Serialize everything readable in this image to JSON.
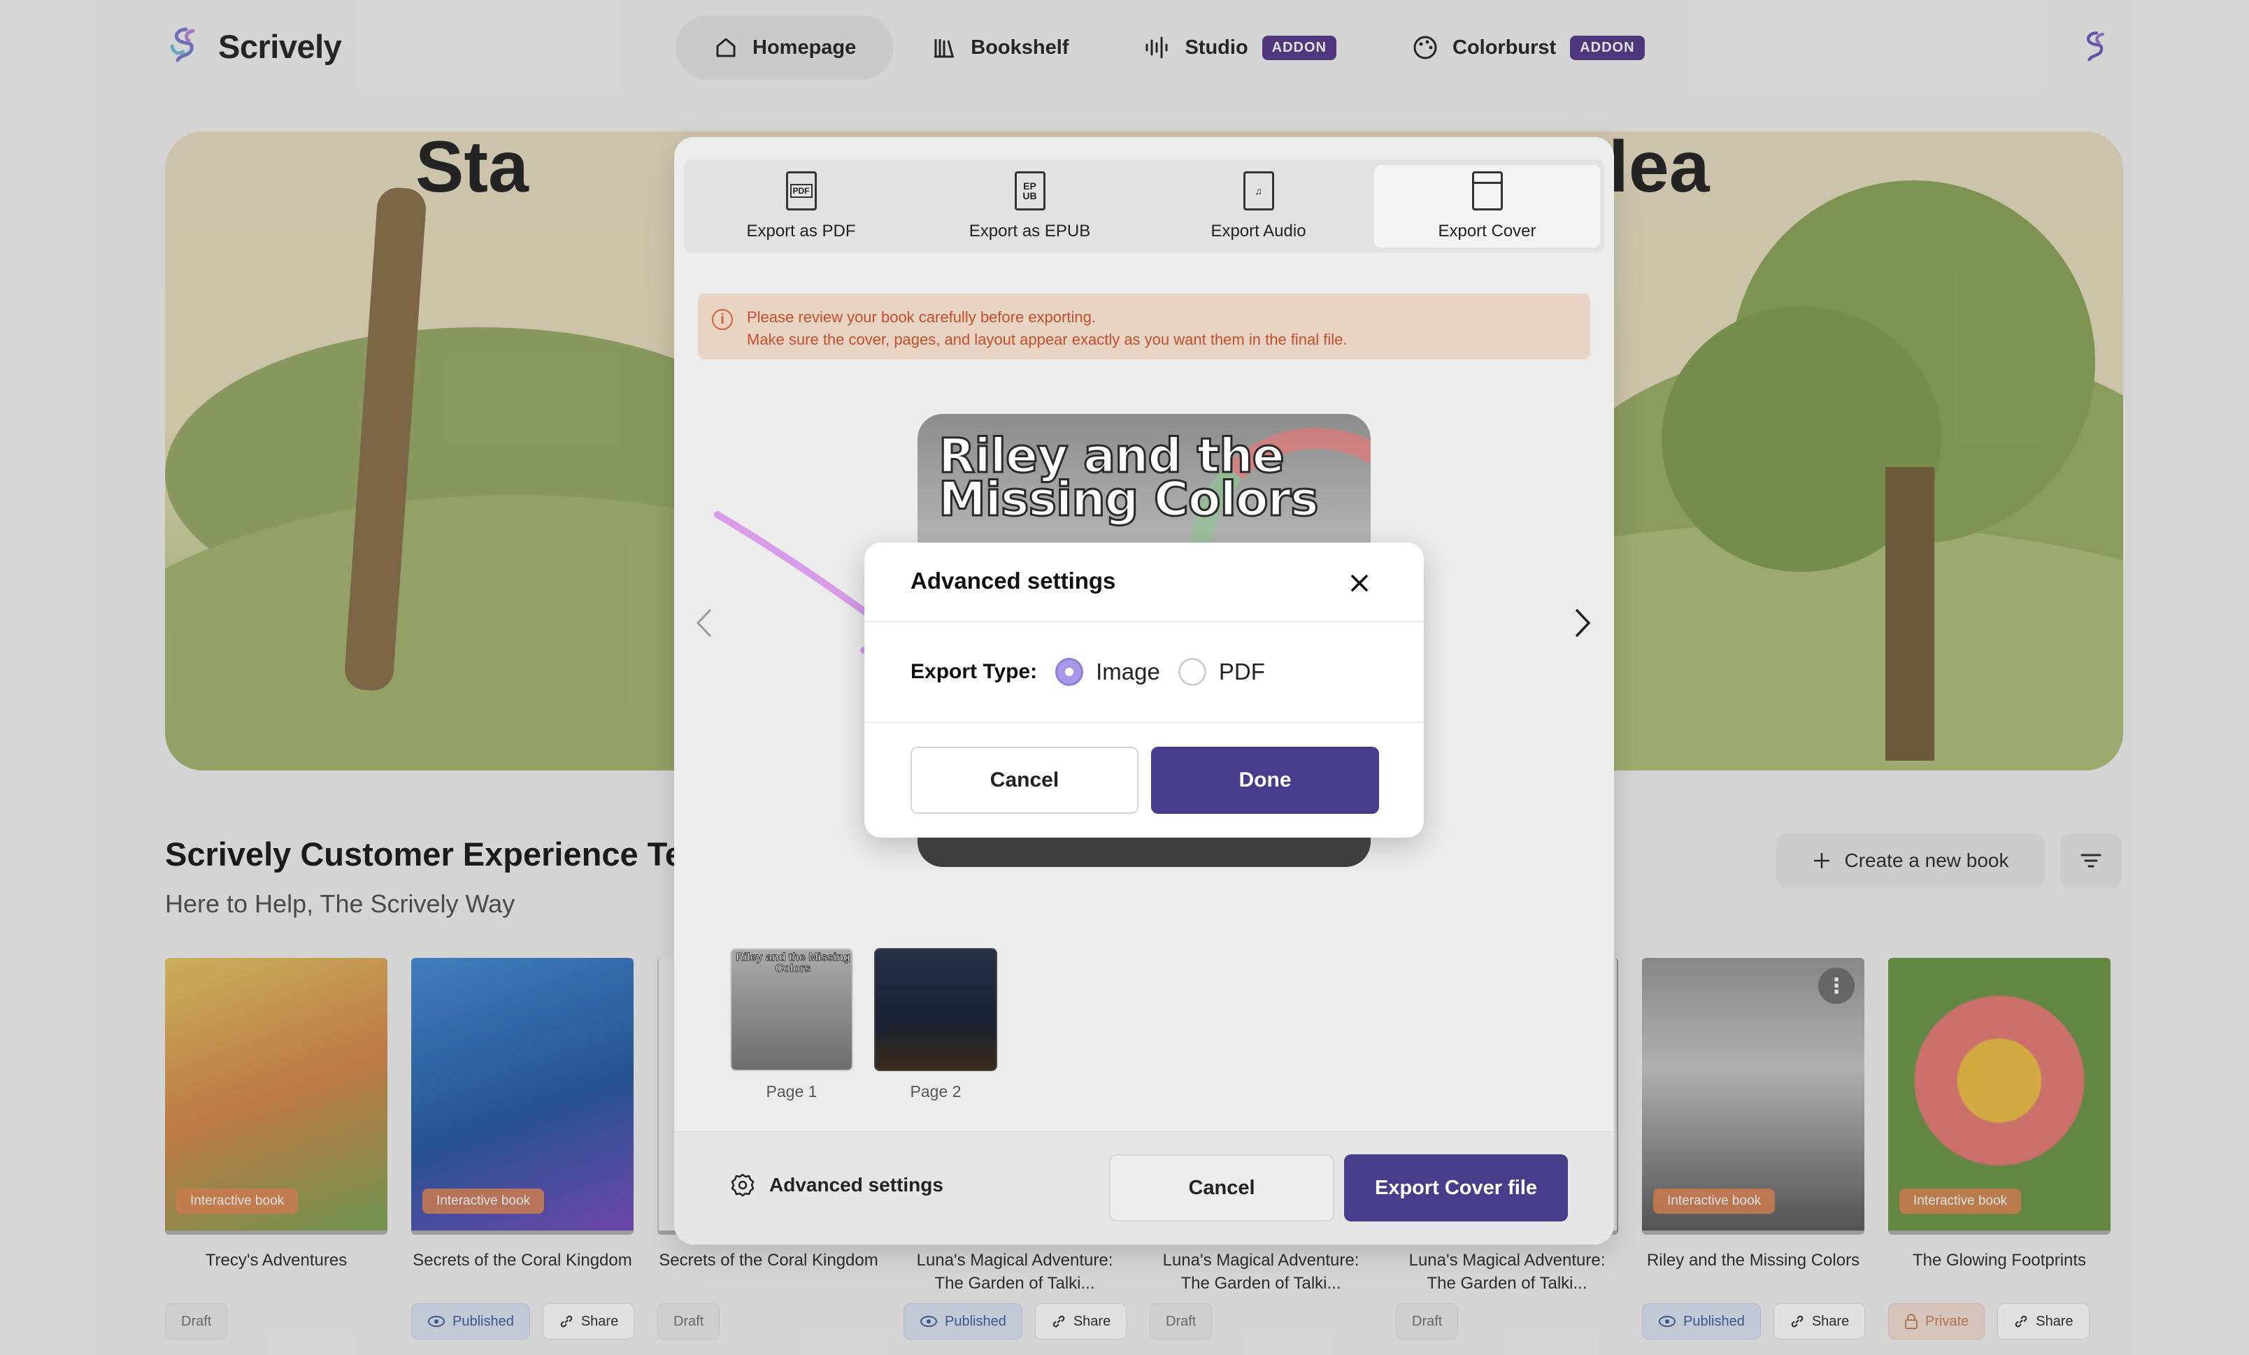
{
  "app": {
    "name": "Scrively"
  },
  "nav": {
    "items": [
      {
        "label": "Homepage",
        "icon": "home-icon"
      },
      {
        "label": "Bookshelf",
        "icon": "bookshelf-icon"
      },
      {
        "label": "Studio",
        "icon": "waveform-icon",
        "badge": "ADDON"
      },
      {
        "label": "Colorburst",
        "icon": "palette-icon",
        "badge": "ADDON"
      }
    ],
    "active": "Homepage"
  },
  "hero": {
    "title_left": "Sta",
    "title_right": "lea"
  },
  "section": {
    "title": "Scrively Customer Experience Te",
    "subtitle": "Here to Help, The Scrively Way",
    "create_label": "Create a new book"
  },
  "books": [
    {
      "title": "Trecy's Adventures",
      "badge": "Interactive book",
      "status": "Draft",
      "share": ""
    },
    {
      "title": "Secrets of the Coral Kingdom",
      "badge": "Interactive book",
      "status": "Published",
      "share": "Share"
    },
    {
      "title": "Secrets of the Coral Kingdom",
      "badge": "",
      "status": "Draft",
      "share": ""
    },
    {
      "title": "Luna's Magical Adventure: The Garden of Talki...",
      "badge": "",
      "status": "Published",
      "share": "Share"
    },
    {
      "title": "Luna's Magical Adventure: The Garden of Talki...",
      "badge": "",
      "status": "Draft",
      "share": ""
    },
    {
      "title": "Luna's Magical Adventure: The Garden of Talki...",
      "badge": "",
      "status": "Draft",
      "share": ""
    },
    {
      "title": "Riley and the Missing Colors",
      "badge": "Interactive book",
      "status": "Published",
      "share": "Share"
    },
    {
      "title": "The Glowing Footprints",
      "badge": "Interactive book",
      "status": "Private",
      "share": "Share"
    }
  ],
  "export_modal": {
    "tabs": [
      {
        "label": "Export as PDF",
        "icon": "pdf-file-icon"
      },
      {
        "label": "Export as EPUB",
        "icon": "epub-file-icon"
      },
      {
        "label": "Export Audio",
        "icon": "audio-file-icon"
      },
      {
        "label": "Export Cover",
        "icon": "cover-file-icon"
      }
    ],
    "active_tab": "Export Cover",
    "warning_line1": "Please review your book carefully before exporting.",
    "warning_line2": "Make sure the cover, pages, and layout appear exactly as you want them in the final file.",
    "preview_title": "Riley and the Missing Colors",
    "thumbs": [
      {
        "label": "Page 1",
        "title": "Riley and the Missing Colors"
      },
      {
        "label": "Page 2"
      }
    ],
    "advanced_label": "Advanced settings",
    "cancel_label": "Cancel",
    "export_label": "Export Cover file"
  },
  "advanced_dialog": {
    "title": "Advanced settings",
    "field_label": "Export Type:",
    "options": [
      "Image",
      "PDF"
    ],
    "selected": "Image",
    "cancel_label": "Cancel",
    "done_label": "Done"
  },
  "colors": {
    "primary": "#483d8b",
    "addon": "#5b3f8f",
    "warning_text": "#c2502c",
    "annotation": "#d79be8"
  }
}
